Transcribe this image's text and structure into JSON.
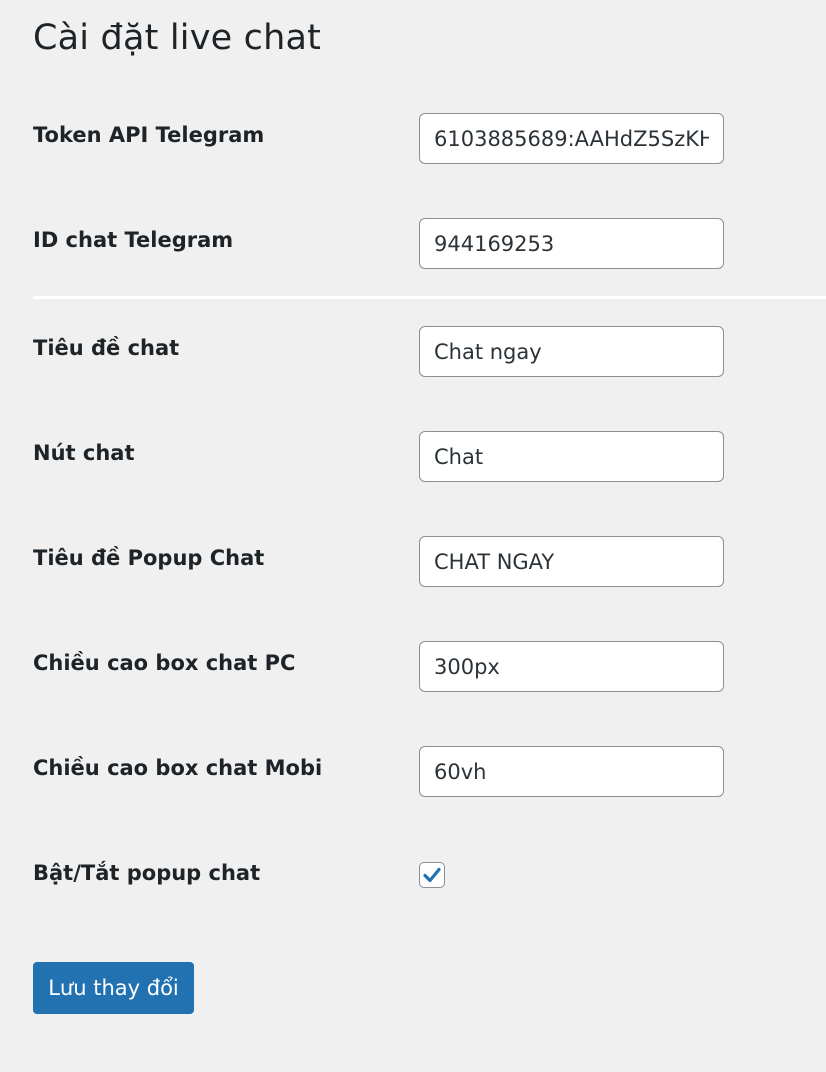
{
  "page": {
    "title": "Cài đặt live chat"
  },
  "fields": [
    {
      "label": "Token API Telegram",
      "value": "6103885689:AAHdZ5SzKH"
    },
    {
      "label": "ID chat Telegram",
      "value": "944169253"
    },
    {
      "label": "Tiêu đề chat",
      "value": "Chat ngay"
    },
    {
      "label": "Nút chat",
      "value": "Chat"
    },
    {
      "label": "Tiêu đề Popup Chat",
      "value": "CHAT NGAY"
    },
    {
      "label": "Chiều cao box chat PC",
      "value": "300px"
    },
    {
      "label": "Chiều cao box chat Mobi",
      "value": "60vh"
    }
  ],
  "toggle": {
    "label": "Bật/Tắt popup chat",
    "checked": true
  },
  "actions": {
    "save_label": "Lưu thay đổi"
  },
  "colors": {
    "primary": "#2271b1",
    "background": "#f0f0f1"
  }
}
